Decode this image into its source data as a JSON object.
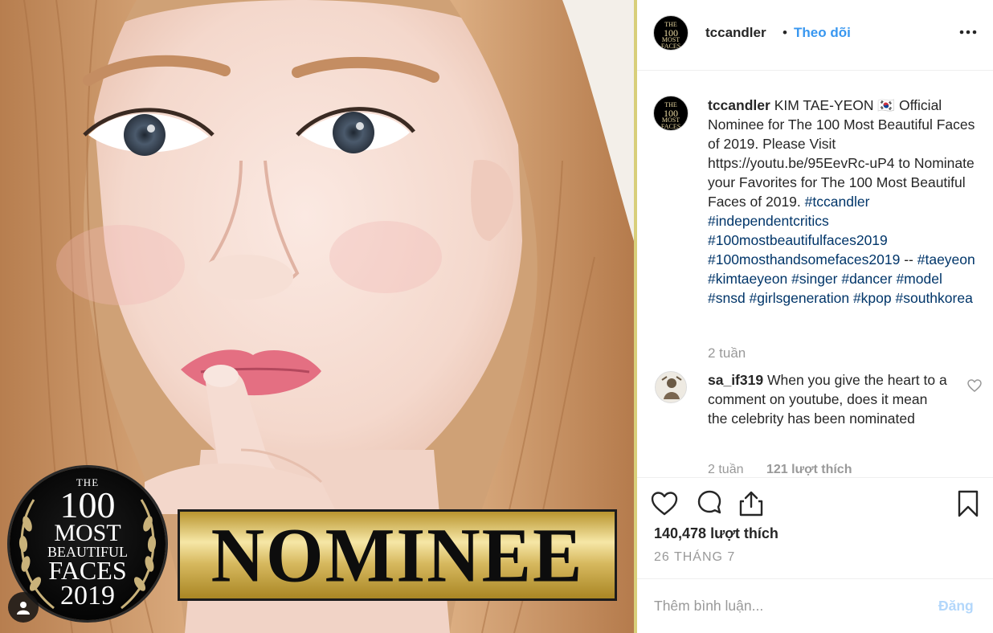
{
  "post": {
    "image_alt": "KIM TAE-YEON nominee portrait",
    "seal": {
      "line1": "THE",
      "line2": "100",
      "line3": "MOST",
      "line4": "BEAUTIFUL",
      "line5": "FACES",
      "line6": "2019"
    },
    "nominee_label": "NOMINEE"
  },
  "header": {
    "username": "tccandler",
    "separator": "•",
    "follow_label": "Theo dõi",
    "more_icon": "more-horizontal-icon"
  },
  "caption": {
    "username": "tccandler",
    "text": "KIM TAE-YEON 🇰🇷  Official Nominee for The 100 Most Beautiful Faces of 2019. Please Visit https://youtu.be/95EevRc-uP4 to Nominate your Favorites for The 100 Most Beautiful Faces of 2019.",
    "hashtags_1": "#tccandler #independentcritics #100mostbeautifulfaces2019 #100mosthandsomefaces2019",
    "dashes": "--",
    "hashtags_2": "#taeyeon #kimtaeyeon #singer #dancer #model #snsd #girlsgeneration #kpop #southkorea",
    "time_ago": "2 tuần"
  },
  "comments": [
    {
      "username": "sa_if319",
      "text": "When you give the heart to a comment on youtube, does it mean the celebrity has been nominated",
      "time_ago": "2 tuần",
      "likes": "121 lượt thích"
    }
  ],
  "actions": {
    "like_icon": "heart-icon",
    "comment_icon": "comment-bubble-icon",
    "share_icon": "share-icon",
    "save_icon": "bookmark-icon",
    "likes_count": "140,478 lượt thích",
    "date": "26 THÁNG 7"
  },
  "add_comment": {
    "placeholder": "Thêm bình luận...",
    "post_label": "Đăng"
  },
  "colors": {
    "link": "#3897f0",
    "hashtag": "#003569",
    "muted": "#999999",
    "post_disabled": "#b3d7fb"
  }
}
